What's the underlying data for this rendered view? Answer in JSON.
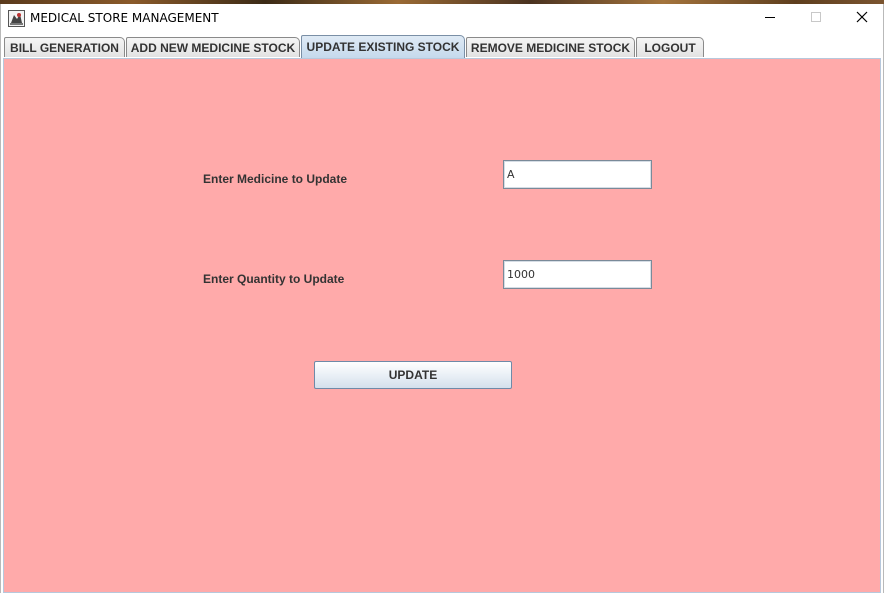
{
  "window": {
    "title": "MEDICAL STORE MANAGEMENT",
    "app_icon": "medical-store-app-icon",
    "controls": {
      "minimize_icon": "minimize-icon",
      "maximize_icon": "maximize-icon",
      "close_icon": "close-icon"
    }
  },
  "tabs": [
    {
      "label": "BILL GENERATION",
      "active": false
    },
    {
      "label": "ADD NEW MEDICINE STOCK",
      "active": false
    },
    {
      "label": "UPDATE EXISTING STOCK",
      "active": true
    },
    {
      "label": "REMOVE MEDICINE STOCK",
      "active": false
    },
    {
      "label": "LOGOUT",
      "active": false
    }
  ],
  "form": {
    "medicine_label": "Enter Medicine to Update",
    "medicine_value": "A",
    "quantity_label": "Enter Quantity to Update",
    "quantity_value": "1000",
    "update_button_label": "UPDATE"
  },
  "colors": {
    "panel_background": "#ffaaaa",
    "active_tab": "#c5d9ec",
    "label_text": "#333333"
  }
}
